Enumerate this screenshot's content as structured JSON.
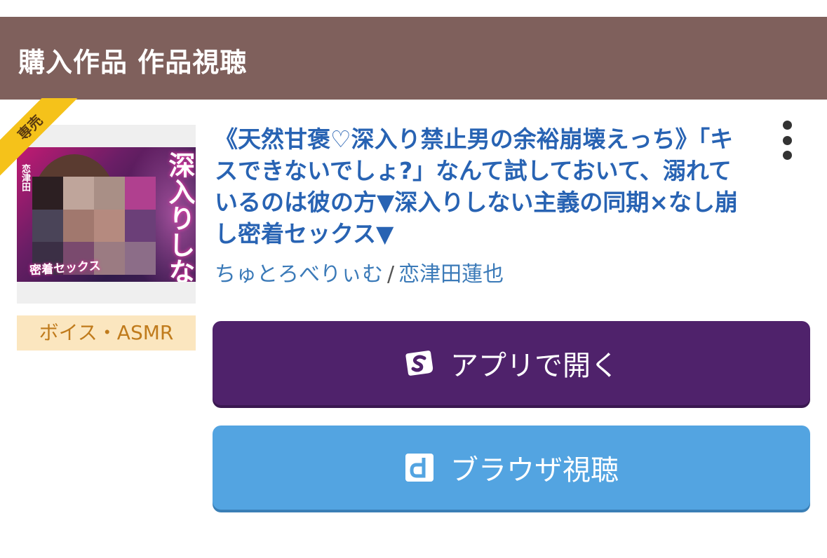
{
  "header": {
    "title": "購入作品 作品視聴"
  },
  "product": {
    "badge": "専売",
    "category": "ボイス・ASMR",
    "title": "《天然甘褒♡深入り禁止男の余裕崩壊えっち》「キスできないでしょ?」なんて試しておいて、溺れているのは彼の方▼深入りしない主義の同期×なし崩し密着セックス▼",
    "circle": "ちゅとろべりぃむ",
    "separator": "/",
    "voice_actor": "恋津田蓮也",
    "cover": {
      "title": "深入りしない主義",
      "subtitle": "密着セックス",
      "author": "恋津田"
    }
  },
  "actions": {
    "app_label": "アプリで開く",
    "app_icon": "app-logo-icon",
    "browser_label": "ブラウザ視聴",
    "browser_icon": "browser-d-icon",
    "more_icon": "more-vertical-icon"
  },
  "colors": {
    "header_bg": "#7f605c",
    "title_link": "#2863b3",
    "app_button": "#4f226b",
    "browser_button": "#53a4e1",
    "category_bg": "#fbe6bf",
    "category_text": "#c07b1c",
    "badge": "#f5c21a"
  }
}
